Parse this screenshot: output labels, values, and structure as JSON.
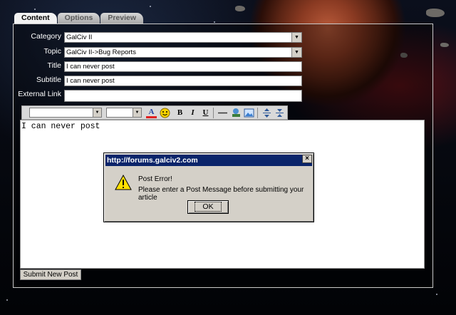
{
  "tabs": [
    {
      "label": "Content",
      "active": true
    },
    {
      "label": "Options",
      "active": false
    },
    {
      "label": "Preview",
      "active": false
    }
  ],
  "form": {
    "category": {
      "label": "Category",
      "value": "GalCiv II"
    },
    "topic": {
      "label": "Topic",
      "value": "GalCiv II->Bug Reports"
    },
    "title": {
      "label": "Title",
      "value": "I can never post"
    },
    "subtitle": {
      "label": "Subtitle",
      "value": "I can never post"
    },
    "external_link": {
      "label": "External Link",
      "value": ""
    }
  },
  "toolbar": {
    "font_select_value": "",
    "size_select_value": "",
    "icons": [
      "font-color-icon",
      "smiley-icon",
      "bold-icon",
      "italic-icon",
      "underline-icon",
      "horizontal-rule-icon",
      "link-icon",
      "image-icon",
      "expand-icon",
      "collapse-icon"
    ],
    "bold_label": "B",
    "italic_label": "I",
    "underline_label": "U",
    "font_color_label": "A"
  },
  "editor": {
    "text": "I can never post"
  },
  "submit_label": "Submit New Post",
  "dialog": {
    "title": "http://forums.galciv2.com",
    "close_label": "×",
    "line1": "Post Error!",
    "line2": "Please enter a Post Message before submitting your article",
    "ok_label": "OK",
    "title_bar_color": "#0a246a"
  }
}
